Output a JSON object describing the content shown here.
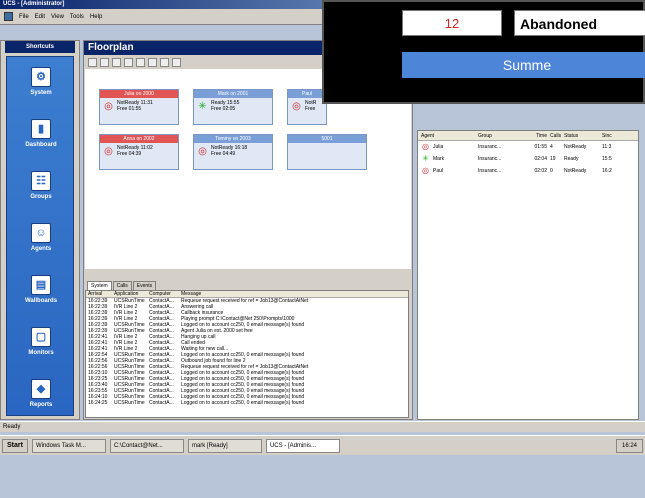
{
  "window": {
    "title": "UCS - [Administrator]"
  },
  "menu": [
    "File",
    "Edit",
    "View",
    "Tools",
    "Help"
  ],
  "sidebar": {
    "header": "Shortcuts",
    "items": [
      {
        "label": "System",
        "icon": "system-icon"
      },
      {
        "label": "Dashboard",
        "icon": "dashboard-icon"
      },
      {
        "label": "Groups",
        "icon": "groups-icon"
      },
      {
        "label": "Agents",
        "icon": "agents-icon"
      },
      {
        "label": "Wallboards",
        "icon": "wallboards-icon"
      },
      {
        "label": "Monitors",
        "icon": "monitors-icon"
      },
      {
        "label": "Reports",
        "icon": "reports-icon"
      }
    ]
  },
  "floorplan": {
    "title": "Floorplan",
    "cards": [
      {
        "title": "Julia on 2000",
        "line1": "NotReady 11:31",
        "line2": "Free      01:55",
        "state": "notready"
      },
      {
        "title": "Mark on 2001",
        "line1": "Ready      15:55",
        "line2": "Free      02:05",
        "state": "ready"
      },
      {
        "title": "Paul",
        "line1": "NotR",
        "line2": "Free",
        "state": "notready"
      },
      {
        "title": "Anna on 2002",
        "line1": "NotReady 11:02",
        "line2": "Free      04:39",
        "state": "notready"
      },
      {
        "title": "Tommy on 2003",
        "line1": "NotReady 16:18",
        "line2": "Free      04:49",
        "state": "notready"
      },
      {
        "title": "5001",
        "line1": "",
        "line2": "",
        "state": "empty"
      }
    ]
  },
  "tabs": [
    "System",
    "Calls",
    "Events"
  ],
  "log": {
    "headers": [
      "Arrival",
      "Application",
      "Computer",
      "Message"
    ],
    "rows": [
      [
        "16:22:39",
        "UCSRunTime",
        "ContactA...",
        "Requeue request received for ref = Job13@ContactAtNet"
      ],
      [
        "16:22:39",
        "IVR Line 2",
        "ContactA...",
        "Answering call"
      ],
      [
        "16:22:39",
        "IVR Line 2",
        "ContactA...",
        "Callback insurance"
      ],
      [
        "16:22:39",
        "IVR Line 2",
        "ContactA...",
        "Playing prompt C:\\Contact@Net 250\\Prompts\\1000"
      ],
      [
        "16:22:39",
        "UCSRunTime",
        "ContactA...",
        "Logged on to account cc250, 0 email message(s) found"
      ],
      [
        "16:22:39",
        "UCSRunTime",
        "ContactA...",
        "Agent Julia on ext. 2000 set free"
      ],
      [
        "16:22:41",
        "IVR Line 2",
        "ContactA...",
        "Hanging up call"
      ],
      [
        "16:22:41",
        "IVR Line 2",
        "ContactA...",
        "Call ended"
      ],
      [
        "16:22:41",
        "IVR Line 2",
        "ContactA...",
        "Waiting for new call..."
      ],
      [
        "16:22:54",
        "UCSRunTime",
        "ContactA...",
        "Logged on to account cc250, 0 email message(s) found"
      ],
      [
        "16:22:56",
        "UCSRunTime",
        "ContactA...",
        "Outbound job found for line 2"
      ],
      [
        "16:22:56",
        "UCSRunTime",
        "ContactA...",
        "Requeue request received for ref = Job13@ContactAtNet"
      ],
      [
        "16:23:10",
        "UCSRunTime",
        "ContactA...",
        "Logged on to account cc250, 0 email message(s) found"
      ],
      [
        "16:23:25",
        "UCSRunTime",
        "ContactA...",
        "Logged on to account cc250, 0 email message(s) found"
      ],
      [
        "16:23:40",
        "UCSRunTime",
        "ContactA...",
        "Logged on to account cc250, 0 email message(s) found"
      ],
      [
        "16:23:55",
        "UCSRunTime",
        "ContactA...",
        "Logged on to account cc250, 0 email message(s) found"
      ],
      [
        "16:24:10",
        "UCSRunTime",
        "ContactA...",
        "Logged on to account cc250, 0 email message(s) found"
      ],
      [
        "16:24:25",
        "UCSRunTime",
        "ContactA...",
        "Logged on to account cc250, 0 email message(s) found"
      ]
    ]
  },
  "agents": {
    "headers": [
      "Agent",
      "Group",
      "Time",
      "Calls",
      "Status",
      "Sinc"
    ],
    "rows": [
      [
        "Julia",
        "Insuranc...",
        "01:55",
        "4",
        "NotReady",
        "11:3"
      ],
      [
        "Mark",
        "Insuranc...",
        "02:04",
        "19",
        "Ready",
        "15:5"
      ],
      [
        "Paul",
        "Insuranc...",
        "02:02",
        "0",
        "NotReady",
        "16:2"
      ]
    ]
  },
  "overlay": {
    "count": "12",
    "label": "Abandoned",
    "summary": "Summe"
  },
  "statusbar": {
    "text": "Ready"
  },
  "taskbar": {
    "start": "Start",
    "tasks": [
      "Windows Task M...",
      "C:\\Contact@Net...",
      "mark [Ready]",
      "UCS - [Adminis..."
    ],
    "clock": "16:24"
  }
}
